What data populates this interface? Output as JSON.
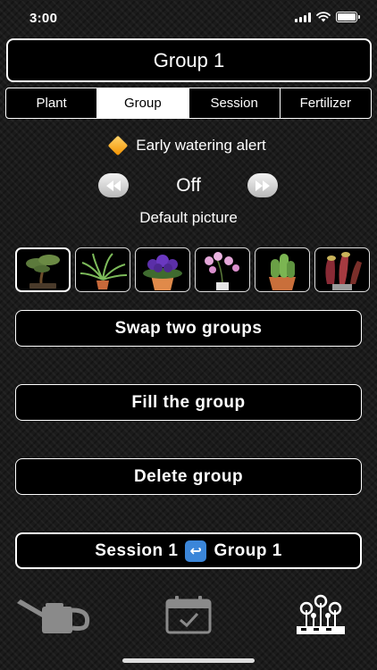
{
  "status": {
    "time": "3:00"
  },
  "header": {
    "title": "Group 1"
  },
  "tabs": [
    {
      "label": "Plant",
      "active": false
    },
    {
      "label": "Group",
      "active": true
    },
    {
      "label": "Session",
      "active": false
    },
    {
      "label": "Fertilizer",
      "active": false
    }
  ],
  "alert": {
    "label": "Early watering alert",
    "icon": "orange-diamond-icon"
  },
  "toggle": {
    "value": "Off",
    "rewind_icon": "rewind-icon",
    "forward_icon": "fast-forward-icon"
  },
  "default_picture": {
    "label": "Default picture",
    "pictures": [
      "bonsai",
      "spider-plant",
      "african-violet",
      "orchid",
      "cactus",
      "pitcher-plant"
    ],
    "selected_index": 0
  },
  "actions": {
    "swap": "Swap two groups",
    "fill": "Fill the group",
    "delete": "Delete group"
  },
  "session_link": {
    "left": "Session 1",
    "icon": "swap-arrows-icon",
    "right": "Group 1"
  },
  "bottom_nav": [
    "watering-can-icon",
    "calendar-check-icon",
    "garden-icon"
  ],
  "colors": {
    "accent_orange": "#f39200",
    "swap_icon_blue": "#3b86d9",
    "background": "#1b1b1b"
  }
}
